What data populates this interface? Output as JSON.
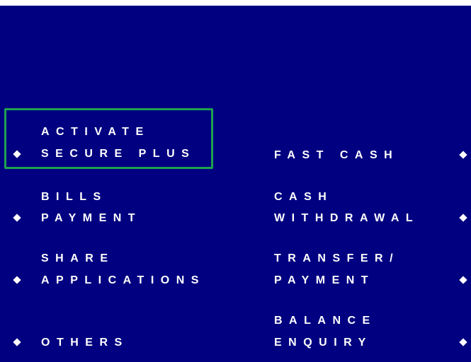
{
  "screen": {
    "background_color": "#000080",
    "text_color": "#ffffff",
    "highlight_color": "#1fa14f"
  },
  "options": {
    "activate_secure_plus": {
      "line1": "ACTIVATE",
      "line2": "SECURE PLUS",
      "icon": "diamond-icon",
      "selected": true
    },
    "bills_payment": {
      "line1": "BILLS",
      "line2": "PAYMENT",
      "icon": "diamond-icon"
    },
    "share_applications": {
      "line1": "SHARE",
      "line2": "APPLICATIONS",
      "icon": "diamond-icon"
    },
    "others": {
      "line1": "OTHERS",
      "icon": "diamond-icon"
    },
    "fast_cash": {
      "line1": "FAST CASH",
      "icon": "diamond-icon"
    },
    "cash_withdrawal": {
      "line1": "CASH",
      "line2": "WITHDRAWAL",
      "icon": "diamond-icon"
    },
    "transfer_payment": {
      "line1": "TRANSFER/",
      "line2": "PAYMENT",
      "icon": "diamond-icon"
    },
    "balance_enquiry": {
      "line1": "BALANCE",
      "line2": "ENQUIRY",
      "icon": "diamond-icon"
    }
  }
}
